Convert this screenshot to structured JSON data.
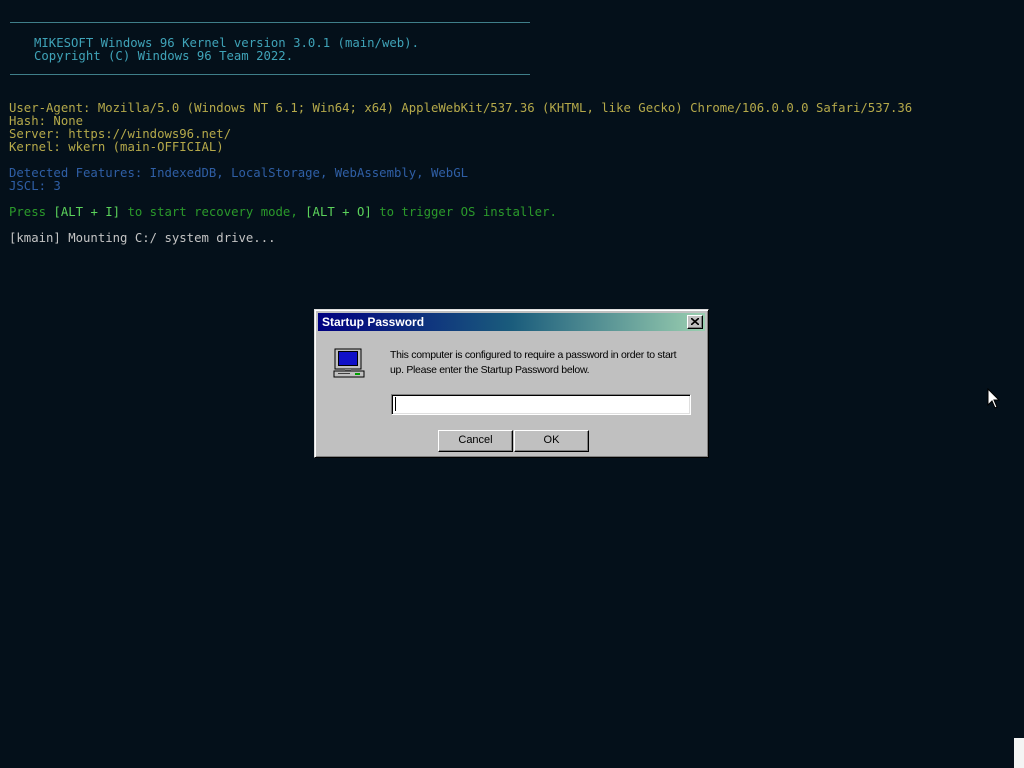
{
  "console": {
    "kernel_line": "MIKESOFT Windows 96 Kernel version 3.0.1 (main/web).",
    "copyright_line": "Copyright (C) Windows 96 Team 2022.",
    "user_agent": "User-Agent: Mozilla/5.0 (Windows NT 6.1; Win64; x64) AppleWebKit/537.36 (KHTML, like Gecko) Chrome/106.0.0.0 Safari/537.36",
    "hash": "Hash: None",
    "server": "Server: https://windows96.net/",
    "kernel": "Kernel: wkern (main-OFFICIAL)",
    "features": "Detected Features: IndexedDB, LocalStorage, WebAssembly, WebGL",
    "jscl": "JSCL: 3",
    "recovery_press": "Press ",
    "recovery_key1": "[ALT + I]",
    "recovery_mid": " to start recovery mode, ",
    "recovery_key2": "[ALT + O]",
    "recovery_end": " to trigger OS installer.",
    "mounting": "[kmain] Mounting C:/ system drive..."
  },
  "dialog": {
    "title": "Startup Password",
    "message": "This computer is configured to require a password in order to start up. Please enter the Startup Password below.",
    "password_value": "",
    "cancel_label": "Cancel",
    "ok_label": "OK"
  },
  "icons": {
    "dialog_icon": "computer-icon",
    "close": "close-icon",
    "pointer": "mouse-pointer-icon"
  },
  "colors": {
    "background": "#04101a",
    "header_text": "#3fa3b8",
    "info_text": "#b5a94a",
    "features_text": "#2f5fa6",
    "hint_text": "#2b9a2b",
    "titlebar_start": "#000080",
    "titlebar_end": "#9bcfb0"
  }
}
